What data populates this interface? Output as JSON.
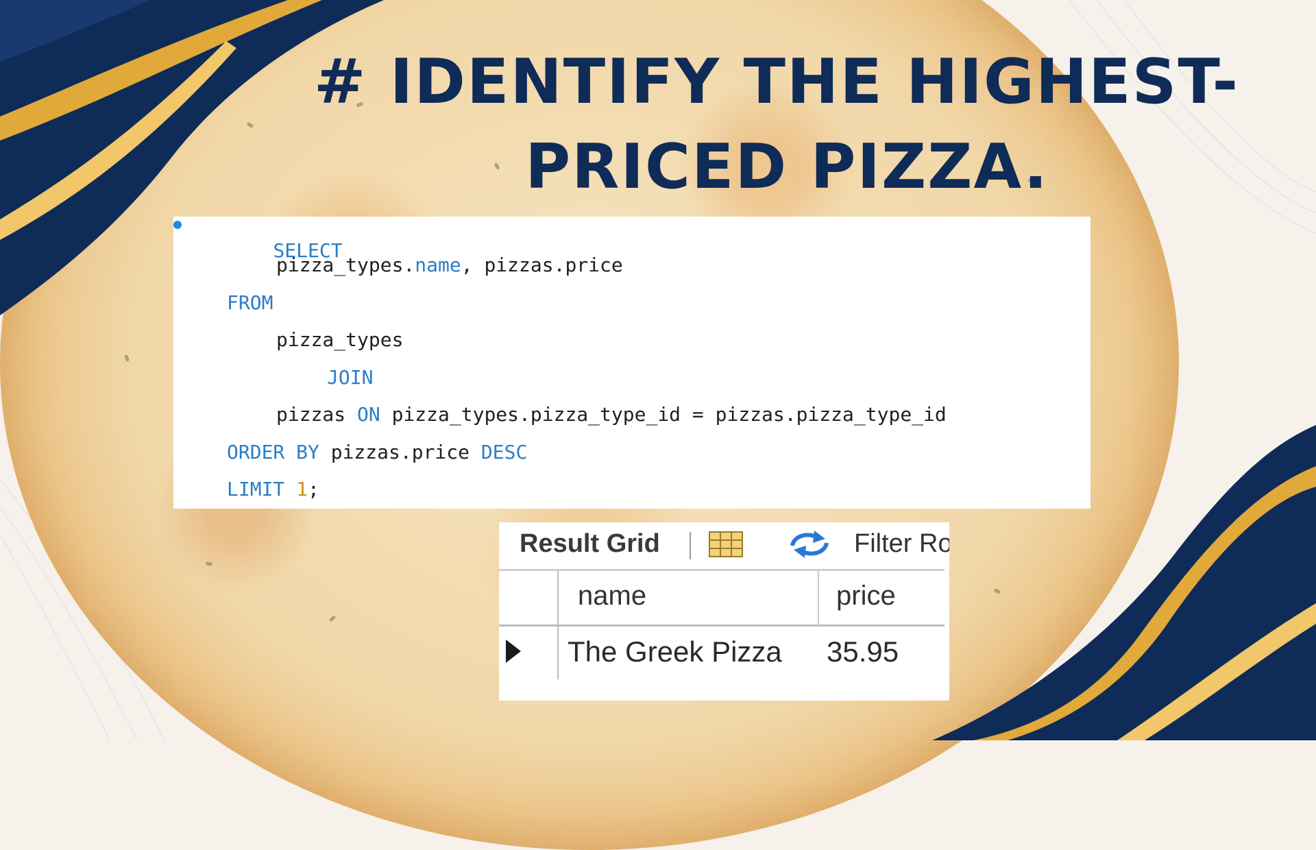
{
  "title": {
    "line1": "# IDENTIFY THE HIGHEST-",
    "line2": "PRICED PIZZA."
  },
  "colors": {
    "navy": "#0f2b57",
    "gold": "#e0a93a",
    "keyword": "#2a7dc7",
    "number": "#d28d1e"
  },
  "sql": {
    "select_kw": "SELECT",
    "select_cols_a": "pizza_types.",
    "select_cols_name": "name",
    "select_cols_b": ", pizzas.price",
    "from_kw": "FROM",
    "from_table": "pizza_types",
    "join_kw": "JOIN",
    "join_table": "pizzas ",
    "on_kw": "ON",
    "on_cond": " pizza_types.pizza_type_id = pizzas.pizza_type_id",
    "order_kw": "ORDER BY",
    "order_col": " pizzas.price ",
    "desc_kw": "DESC",
    "limit_kw": "LIMIT ",
    "limit_val": "1",
    "semicolon": ";"
  },
  "result_grid": {
    "toolbar_label": "Result Grid",
    "filter_label": "Filter Ro",
    "grid_icon": "grid-layout-icon",
    "refresh_icon": "refresh-icon",
    "columns": [
      "name",
      "price"
    ],
    "rows": [
      {
        "name": "The Greek Pizza",
        "price": "35.95"
      }
    ]
  }
}
